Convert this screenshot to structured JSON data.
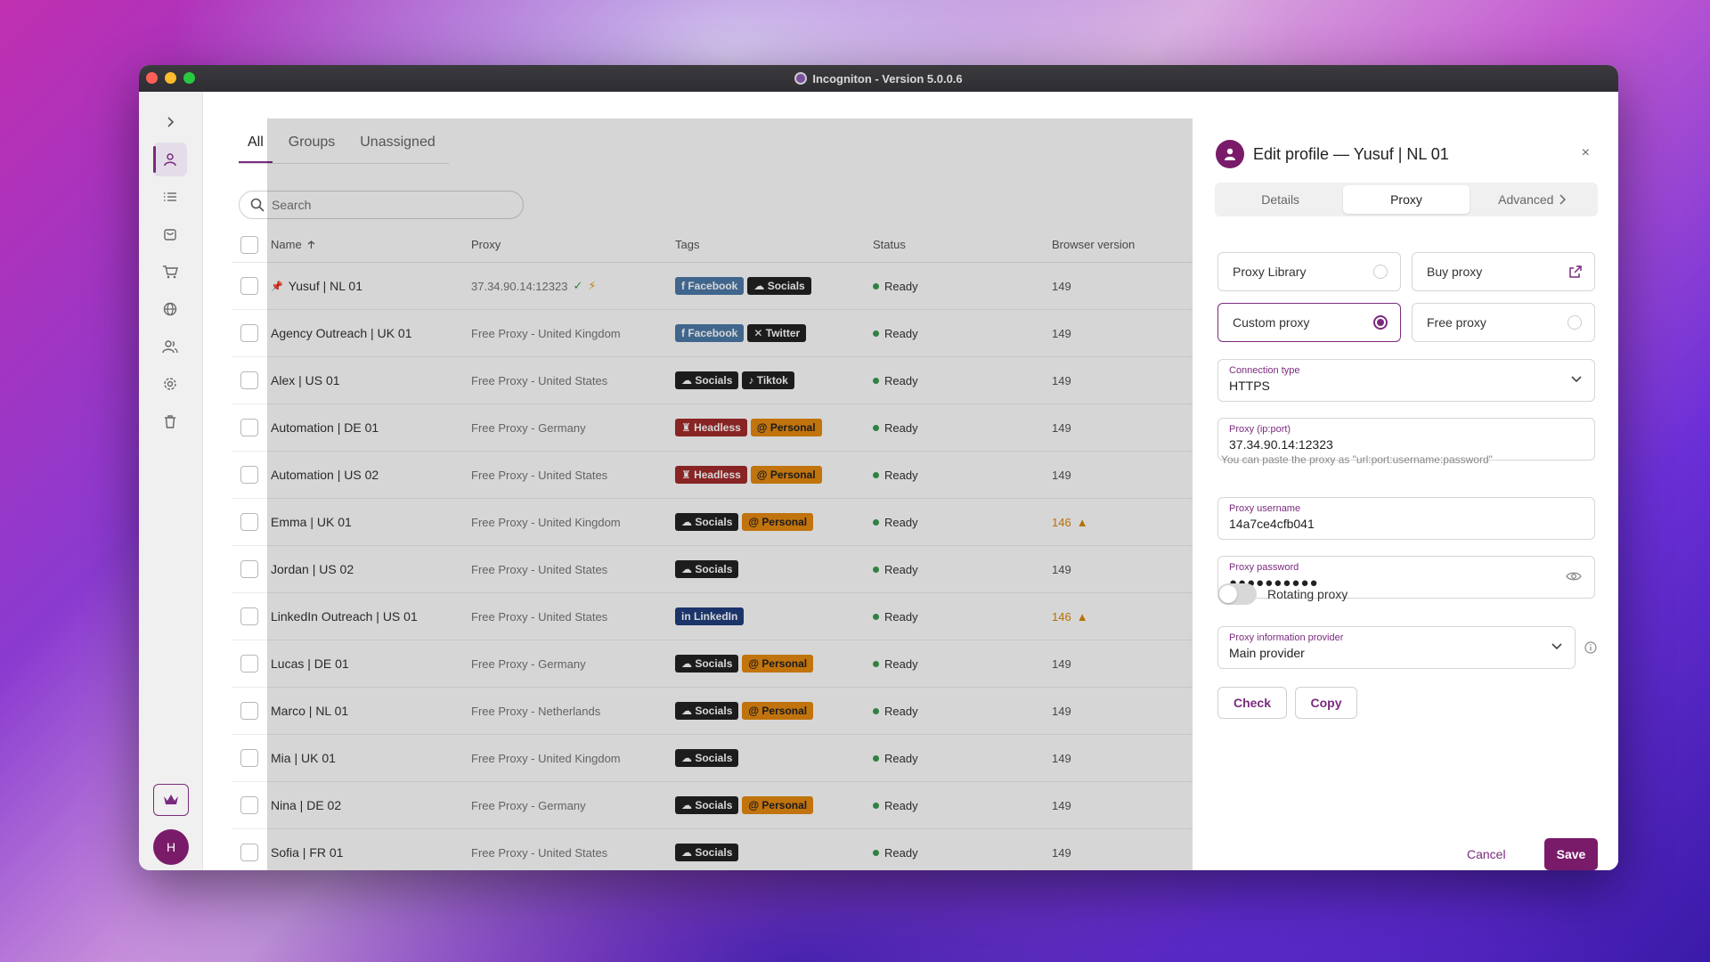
{
  "window": {
    "title": "Incogniton - Version 5.0.0.6"
  },
  "tabs": [
    {
      "label": "All"
    },
    {
      "label": "Groups"
    },
    {
      "label": "Unassigned"
    }
  ],
  "search": {
    "placeholder": "Search"
  },
  "table": {
    "headers": {
      "name": "Name",
      "sort_icon": "arrow-up-icon",
      "proxy": "Proxy",
      "tags": "Tags",
      "status": "Status",
      "browser_version": "Browser version"
    },
    "rows": [
      {
        "name": "Yusuf | NL 01",
        "pinned": true,
        "proxy": "37.34.90.14:12323",
        "tags": [
          "Facebook",
          "Socials"
        ],
        "status": "Ready",
        "version": "149"
      },
      {
        "name": "Agency Outreach | UK 01",
        "proxy": "Free Proxy - United Kingdom",
        "tags": [
          "Facebook",
          "Twitter"
        ],
        "status": "Ready",
        "version": "149"
      },
      {
        "name": "Alex | US 01",
        "proxy": "Free Proxy - United States",
        "tags": [
          "Socials",
          "Tiktok"
        ],
        "status": "Ready",
        "version": "149"
      },
      {
        "name": "Automation | DE 01",
        "proxy": "Free Proxy - Germany",
        "tags": [
          "Headless",
          "Personal"
        ],
        "status": "Ready",
        "version": "149"
      },
      {
        "name": "Automation | US 02",
        "proxy": "Free Proxy - United States",
        "tags": [
          "Headless",
          "Personal"
        ],
        "status": "Ready",
        "version": "149"
      },
      {
        "name": "Emma | UK 01",
        "proxy": "Free Proxy - United Kingdom",
        "tags": [
          "Socials",
          "Personal"
        ],
        "status": "Ready",
        "version": "146",
        "warning": true
      },
      {
        "name": "Jordan | US 02",
        "proxy": "Free Proxy - United States",
        "tags": [
          "Socials"
        ],
        "status": "Ready",
        "version": "149"
      },
      {
        "name": "LinkedIn Outreach | US 01",
        "proxy": "Free Proxy - United States",
        "tags": [
          "LinkedIn"
        ],
        "status": "Ready",
        "version": "146",
        "warning": true
      },
      {
        "name": "Lucas | DE 01",
        "proxy": "Free Proxy - Germany",
        "tags": [
          "Socials",
          "Personal"
        ],
        "status": "Ready",
        "version": "149"
      },
      {
        "name": "Marco | NL 01",
        "proxy": "Free Proxy - Netherlands",
        "tags": [
          "Socials",
          "Personal"
        ],
        "status": "Ready",
        "version": "149"
      },
      {
        "name": "Mia | UK 01",
        "proxy": "Free Proxy - United Kingdom",
        "tags": [
          "Socials"
        ],
        "status": "Ready",
        "version": "149"
      },
      {
        "name": "Nina | DE 02",
        "proxy": "Free Proxy - Germany",
        "tags": [
          "Socials",
          "Personal"
        ],
        "status": "Ready",
        "version": "149"
      },
      {
        "name": "Sofia | FR 01",
        "proxy": "Free Proxy - United States",
        "tags": [
          "Socials"
        ],
        "status": "Ready",
        "version": "149"
      }
    ]
  },
  "sidebar": {
    "avatar_initial": "H",
    "icons": [
      "chevron-right-icon",
      "user-icon",
      "list-icon",
      "bag-icon",
      "cart-icon",
      "globe-icon",
      "users-icon",
      "gear-icon",
      "trash-icon",
      "crown-icon"
    ]
  },
  "panel": {
    "title": "Edit profile — Yusuf | NL 01",
    "close": "×",
    "tabs": {
      "details": "Details",
      "proxy": "Proxy",
      "advanced": "Advanced"
    },
    "options": {
      "proxy_library": "Proxy Library",
      "buy_proxy": "Buy proxy",
      "custom_proxy": "Custom proxy",
      "free_proxy": "Free proxy",
      "selected": "custom_proxy"
    },
    "connection_type": {
      "label": "Connection type",
      "value": "HTTPS"
    },
    "proxy_ip_port": {
      "label": "Proxy (ip:port)",
      "value": "37.34.90.14:12323"
    },
    "hint": "You can paste the proxy as \"url:port:username:password\"",
    "proxy_username": {
      "label": "Proxy username",
      "value": "14a7ce4cfb041"
    },
    "proxy_password": {
      "label": "Proxy password",
      "value": "●●●●●●●●●●"
    },
    "rotating_proxy": {
      "label": "Rotating proxy",
      "enabled": false
    },
    "provider": {
      "label": "Proxy information provider",
      "value": "Main provider"
    },
    "buttons": {
      "check": "Check",
      "copy": "Copy",
      "cancel": "Cancel",
      "save": "Save"
    }
  },
  "colors": {
    "accent": "#7a2b7e",
    "save_bg": "#7a1b6a",
    "tag_facebook": "#4d7aa8",
    "tag_dark": "#222222",
    "tag_headless": "#a42b2b",
    "tag_personal": "#e68a10",
    "tag_linkedin": "#21407f",
    "status_ready": "#3a9a4e",
    "warning": "#d9870a"
  }
}
